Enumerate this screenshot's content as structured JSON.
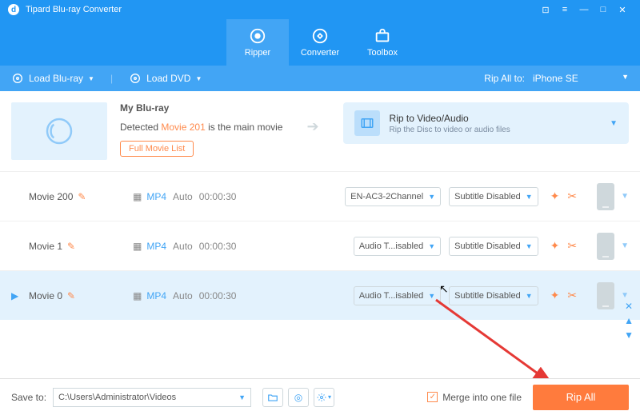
{
  "app": {
    "title": "Tipard Blu-ray Converter"
  },
  "tabs": {
    "ripper": "Ripper",
    "converter": "Converter",
    "toolbox": "Toolbox"
  },
  "loadbar": {
    "load_bluray": "Load Blu-ray",
    "load_dvd": "Load DVD",
    "rip_all_to_label": "Rip All to:",
    "rip_all_to_value": "iPhone SE"
  },
  "header": {
    "title": "My Blu-ray",
    "detected_prefix": "Detected ",
    "main_movie": "Movie 201",
    "detected_suffix": " is the main movie",
    "full_list": "Full Movie List",
    "rip_target_title": "Rip to Video/Audio",
    "rip_target_sub": "Rip the Disc to video or audio files"
  },
  "rows": [
    {
      "name": "Movie 200",
      "fmt": "MP4",
      "auto": "Auto",
      "dur": "00:00:30",
      "audio": "EN-AC3-2Channel",
      "subtitle": "Subtitle Disabled",
      "selected": false
    },
    {
      "name": "Movie 1",
      "fmt": "MP4",
      "auto": "Auto",
      "dur": "00:00:30",
      "audio": "Audio T...isabled",
      "subtitle": "Subtitle Disabled",
      "selected": false
    },
    {
      "name": "Movie 0",
      "fmt": "MP4",
      "auto": "Auto",
      "dur": "00:00:30",
      "audio": "Audio T...isabled",
      "subtitle": "Subtitle Disabled",
      "selected": true
    }
  ],
  "footer": {
    "save_to": "Save to:",
    "path": "C:\\Users\\Administrator\\Videos",
    "merge": "Merge into one file",
    "rip_all": "Rip All"
  }
}
